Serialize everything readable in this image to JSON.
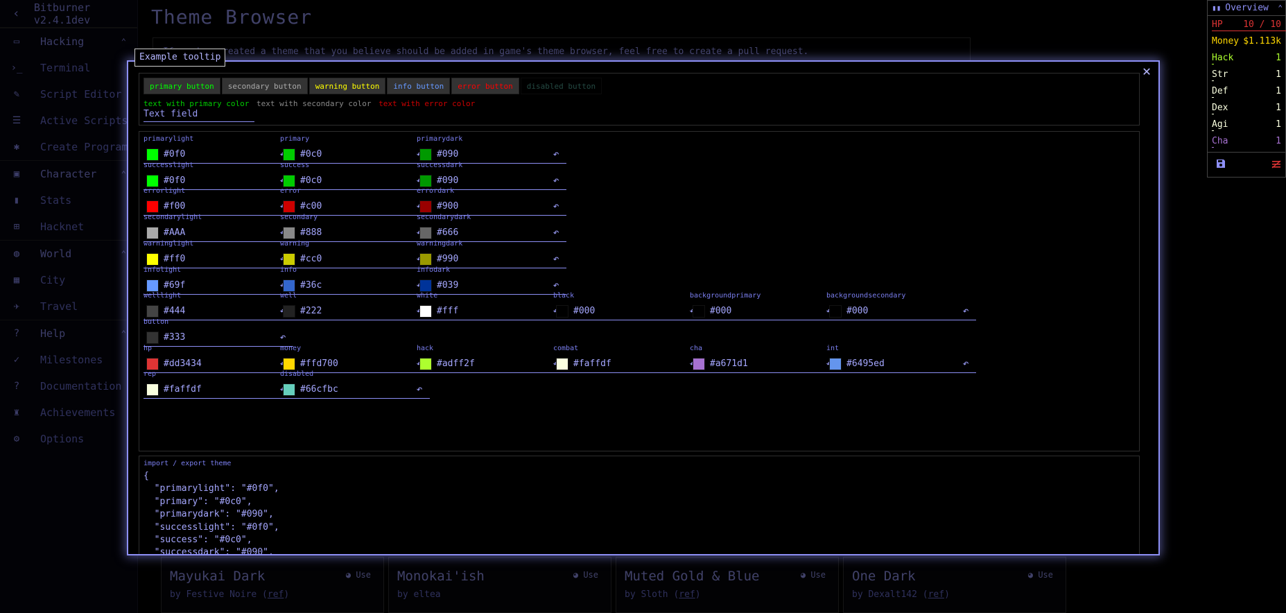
{
  "sidebar": {
    "title": "Bitburner v2.4.1dev",
    "sections": [
      {
        "label": "Hacking",
        "icon": "laptop-icon",
        "items": [
          {
            "label": "Terminal",
            "icon": "terminal-icon"
          },
          {
            "label": "Script Editor",
            "icon": "pencil-icon"
          },
          {
            "label": "Active Scripts",
            "icon": "list-icon"
          },
          {
            "label": "Create Program",
            "icon": "bug-icon"
          }
        ]
      },
      {
        "label": "Character",
        "icon": "account-box-icon",
        "items": [
          {
            "label": "Stats",
            "icon": "equalizer-icon"
          },
          {
            "label": "Hacknet",
            "icon": "account-tree-icon"
          }
        ]
      },
      {
        "label": "World",
        "icon": "globe-icon",
        "items": [
          {
            "label": "City",
            "icon": "city-icon"
          },
          {
            "label": "Travel",
            "icon": "airplane-icon"
          }
        ]
      },
      {
        "label": "Help",
        "icon": "help-icon",
        "items": [
          {
            "label": "Milestones",
            "icon": "check-icon"
          },
          {
            "label": "Documentation",
            "icon": "question-icon"
          },
          {
            "label": "Achievements",
            "icon": "trophy-icon"
          },
          {
            "label": "Options",
            "icon": "gear-icon"
          }
        ]
      }
    ]
  },
  "page": {
    "title": "Theme Browser",
    "note": "If you've created a theme that you believe should be added in game's theme browser, feel free to create a pull request.",
    "cards": [
      {
        "name": "Mayukai Dark",
        "by": "by Festive Noire (",
        "ref": "ref",
        "close": ")",
        "use": "Use"
      },
      {
        "name": "Monokai'ish",
        "by": "by eltea",
        "ref": "",
        "close": "",
        "use": "Use"
      },
      {
        "name": "Muted Gold & Blue",
        "by": "by Sloth (",
        "ref": "ref",
        "close": ")",
        "use": "Use"
      },
      {
        "name": "One Dark",
        "by": "by Dexalt142 (",
        "ref": "ref",
        "close": ")",
        "use": "Use"
      }
    ]
  },
  "overview": {
    "title": "Overview",
    "rows": [
      {
        "label": "HP",
        "value": "10 / 10",
        "color": "#dd3434",
        "bar": "#dd3434"
      },
      {
        "label": "Money",
        "value": "$1.113k",
        "color": "#ffd700",
        "bar": ""
      },
      {
        "label": "Hack",
        "value": "1",
        "color": "#adff2f",
        "bar": "#adff2f"
      },
      {
        "label": "Str",
        "value": "1",
        "color": "#faffdf",
        "bar": "#faffdf"
      },
      {
        "label": "Def",
        "value": "1",
        "color": "#faffdf",
        "bar": "#faffdf"
      },
      {
        "label": "Dex",
        "value": "1",
        "color": "#faffdf",
        "bar": "#faffdf"
      },
      {
        "label": "Agi",
        "value": "1",
        "color": "#faffdf",
        "bar": "#faffdf"
      },
      {
        "label": "Cha",
        "value": "1",
        "color": "#a671d1",
        "bar": "#a671d1"
      }
    ]
  },
  "tooltip": "Example tooltip",
  "demo": {
    "buttons": [
      {
        "label": "primary button",
        "color": "#0f0"
      },
      {
        "label": "secondary button",
        "color": "#AAA"
      },
      {
        "label": "warning button",
        "color": "#ff0"
      },
      {
        "label": "info button",
        "color": "#69f"
      },
      {
        "label": "error button",
        "color": "#f00"
      },
      {
        "label": "disabled button",
        "color": "#66cfbc"
      }
    ],
    "texts": [
      {
        "label": "text with primary color",
        "color": "#0c0"
      },
      {
        "label": "text with secondary color",
        "color": "#888"
      },
      {
        "label": "text with error color",
        "color": "#c00"
      }
    ],
    "text_field": "Text field"
  },
  "colors": [
    {
      "key": "primarylight",
      "value": "#0f0",
      "sw": "#00ff00"
    },
    {
      "key": "primary",
      "value": "#0c0",
      "sw": "#00cc00"
    },
    {
      "key": "primarydark",
      "value": "#090",
      "sw": "#009900"
    },
    {
      "key": "successlight",
      "value": "#0f0",
      "sw": "#00ff00"
    },
    {
      "key": "success",
      "value": "#0c0",
      "sw": "#00cc00"
    },
    {
      "key": "successdark",
      "value": "#090",
      "sw": "#009900"
    },
    {
      "key": "errorlight",
      "value": "#f00",
      "sw": "#ff0000"
    },
    {
      "key": "error",
      "value": "#c00",
      "sw": "#cc0000"
    },
    {
      "key": "errordark",
      "value": "#900",
      "sw": "#990000"
    },
    {
      "key": "secondarylight",
      "value": "#AAA",
      "sw": "#aaaaaa"
    },
    {
      "key": "secondary",
      "value": "#888",
      "sw": "#888888"
    },
    {
      "key": "secondarydark",
      "value": "#666",
      "sw": "#666666"
    },
    {
      "key": "warninglight",
      "value": "#ff0",
      "sw": "#ffff00"
    },
    {
      "key": "warning",
      "value": "#cc0",
      "sw": "#cccc00"
    },
    {
      "key": "warningdark",
      "value": "#990",
      "sw": "#999900"
    },
    {
      "key": "infolight",
      "value": "#69f",
      "sw": "#6699ff"
    },
    {
      "key": "info",
      "value": "#36c",
      "sw": "#3366cc"
    },
    {
      "key": "infodark",
      "value": "#039",
      "sw": "#003399"
    },
    {
      "key": "welllight",
      "value": "#444",
      "sw": "#444444"
    },
    {
      "key": "well",
      "value": "#222",
      "sw": "#222222"
    },
    {
      "key": "white",
      "value": "#fff",
      "sw": "#ffffff"
    },
    {
      "key": "black",
      "value": "#000",
      "sw": "#000000"
    },
    {
      "key": "backgroundprimary",
      "value": "#000",
      "sw": "#000000"
    },
    {
      "key": "backgroundsecondary",
      "value": "#000",
      "sw": "#000000"
    },
    {
      "key": "button",
      "value": "#333",
      "sw": "#333333"
    },
    {
      "key": "hp",
      "value": "#dd3434",
      "sw": "#dd3434"
    },
    {
      "key": "money",
      "value": "#ffd700",
      "sw": "#ffd700"
    },
    {
      "key": "hack",
      "value": "#adff2f",
      "sw": "#adff2f"
    },
    {
      "key": "combat",
      "value": "#faffdf",
      "sw": "#faffdf"
    },
    {
      "key": "cha",
      "value": "#a671d1",
      "sw": "#a671d1"
    },
    {
      "key": "int",
      "value": "#6495ed",
      "sw": "#6495ed"
    },
    {
      "key": "rep",
      "value": "#faffdf",
      "sw": "#faffdf"
    },
    {
      "key": "disabled",
      "value": "#66cfbc",
      "sw": "#66cfbc"
    }
  ],
  "import_export": {
    "label": "import / export theme",
    "text": "{\n  \"primarylight\": \"#0f0\",\n  \"primary\": \"#0c0\",\n  \"primarydark\": \"#090\",\n  \"successlight\": \"#0f0\",\n  \"success\": \"#0c0\",\n  \"successdark\": \"#090\","
  }
}
